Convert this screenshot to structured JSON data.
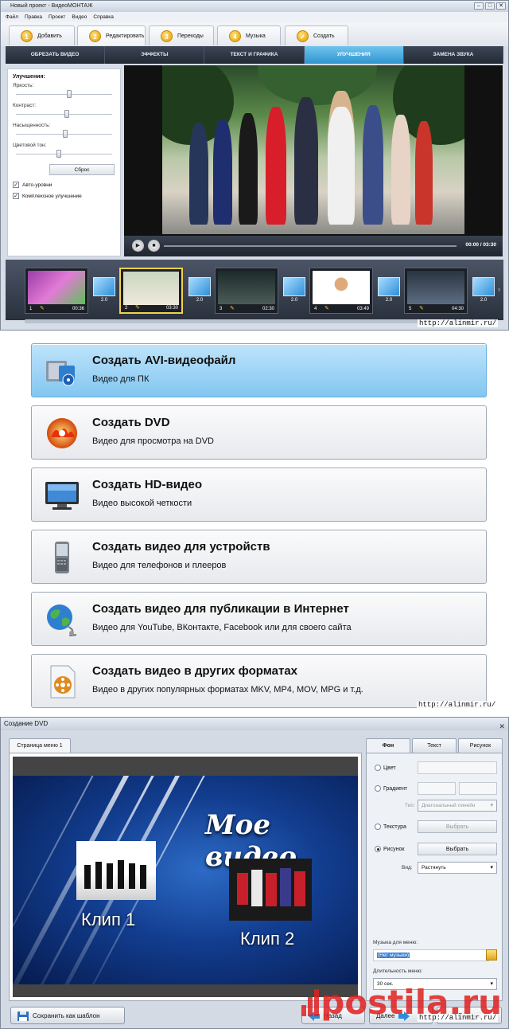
{
  "editor": {
    "title": "Новый проект - ВидеоМОНТАЖ",
    "menu": [
      "Файл",
      "Правка",
      "Проект",
      "Видео",
      "Справка"
    ],
    "steps": [
      {
        "num": "1",
        "label": "Добавить"
      },
      {
        "num": "2",
        "label": "Редактировать"
      },
      {
        "num": "3",
        "label": "Переходы"
      },
      {
        "num": "4",
        "label": "Музыка"
      },
      {
        "num": "✓",
        "label": "Создать"
      }
    ],
    "tabs": [
      "ОБРЕЗАТЬ ВИДЕО",
      "ЭФФЕКТЫ",
      "ТЕКСТ И ГРАФИКА",
      "УЛУЧШЕНИЯ",
      "ЗАМЕНА ЗВУКА"
    ],
    "active_tab": 3,
    "panel": {
      "heading": "Улучшения:",
      "sliders": [
        {
          "label": "Яркость:",
          "value": 0.55
        },
        {
          "label": "Контраст:",
          "value": 0.52
        },
        {
          "label": "Насыщенность:",
          "value": 0.5
        },
        {
          "label": "Цветовой тон:",
          "value": 0.44
        }
      ],
      "reset": "Сброс",
      "checkboxes": [
        {
          "label": "Авто-уровни",
          "checked": true
        },
        {
          "label": "Комплексное улучшение",
          "checked": true
        }
      ]
    },
    "player": {
      "time": "00:00 / 03:30"
    },
    "timeline": {
      "clips": [
        {
          "num": "1",
          "duration": "00:36"
        },
        {
          "num": "2",
          "duration": "03:30"
        },
        {
          "num": "3",
          "duration": "02:30"
        },
        {
          "num": "4",
          "duration": "03:49"
        },
        {
          "num": "5",
          "duration": "04:30"
        }
      ],
      "transitions": [
        "2.0",
        "2.0",
        "2.0",
        "2.0",
        "2.0"
      ]
    }
  },
  "watermark": "http://alinmir.ru/",
  "export_options": [
    {
      "title": "Создать AVI-видеофайл",
      "subtitle": "Видео для ПК",
      "active": true
    },
    {
      "title": "Создать DVD",
      "subtitle": "Видео для просмотра на DVD"
    },
    {
      "title": "Создать HD-видео",
      "subtitle": "Видео высокой четкости"
    },
    {
      "title": "Создать видео для устройств",
      "subtitle": "Видео для телефонов и плееров"
    },
    {
      "title": "Создать видео для публикации в Интернет",
      "subtitle": "Видео для YouTube, ВКонтакте, Facebook или для своего сайта"
    },
    {
      "title": "Создать видео в других форматах",
      "subtitle": "Видео в других популярных форматах MKV, MP4, MOV, MPG и т.д."
    }
  ],
  "dvd_dialog": {
    "title": "Создание DVD",
    "page_tab": "Страница меню 1",
    "menu_title": "Мое видео",
    "clip1": "Клип 1",
    "clip2": "Клип 2",
    "right_tabs": [
      "Фон",
      "Текст",
      "Рисунок"
    ],
    "options": {
      "color": "Цвет",
      "gradient": "Градиент",
      "type_label": "Тип:",
      "type_value": "Диагональный линейн",
      "texture": "Текстура",
      "texture_btn": "Выбрать",
      "picture": "Рисунок",
      "picture_btn": "Выбрать",
      "view_label": "Вид:",
      "view_value": "Растянуть"
    },
    "music_label": "Музыка для меню:",
    "music_value": "(Нет музыки)",
    "duration_label": "Длительность меню:",
    "duration_value": "30 сек.",
    "buttons": {
      "save_template": "Сохранить как шаблон",
      "back": "Назад",
      "next": "Далее",
      "cancel": "Отмена"
    },
    "logo_text": "postila.ru"
  },
  "colors": {
    "accent": "#3aa4dd",
    "active_option": "#9fd4f6",
    "dvd_bg": "#123d8f",
    "logo": "#e02020"
  }
}
